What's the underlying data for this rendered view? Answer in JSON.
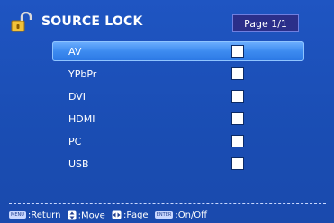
{
  "header": {
    "title": "SOURCE LOCK",
    "page": "Page 1/1"
  },
  "list": {
    "items": [
      {
        "label": "AV",
        "selected": true,
        "checked": false
      },
      {
        "label": "YPbPr",
        "selected": false,
        "checked": false
      },
      {
        "label": "DVI",
        "selected": false,
        "checked": false
      },
      {
        "label": "HDMI",
        "selected": false,
        "checked": false
      },
      {
        "label": "PC",
        "selected": false,
        "checked": false
      },
      {
        "label": "USB",
        "selected": false,
        "checked": false
      }
    ]
  },
  "footer": {
    "menu_key": "MENU",
    "return_label": ":Return",
    "move_label": ":Move",
    "page_label": ":Page",
    "enter_key": "ENTER",
    "onoff_label": ":On/Off"
  },
  "icons": {
    "lock": "unlocked-padlock-icon",
    "move": "up-down-arrow-icon",
    "page": "left-right-arrow-icon"
  },
  "colors": {
    "background": "#1a4fb8",
    "highlight": "#3d8bf0",
    "badge": "#2b2f8a"
  }
}
